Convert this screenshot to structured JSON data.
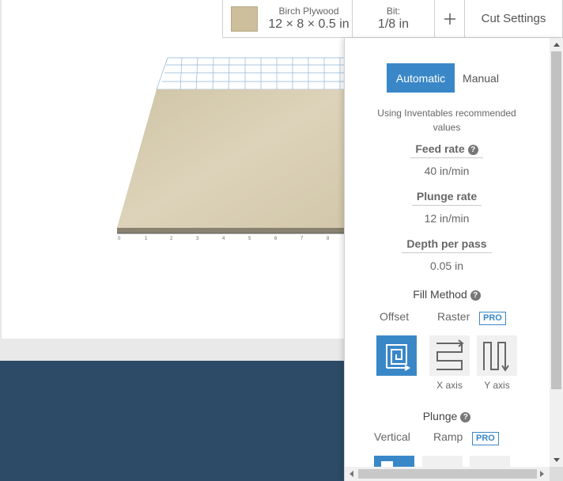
{
  "toolbar": {
    "material_name": "Birch Plywood",
    "material_dims": "12 × 8 × 0.5 in",
    "material_color": "#cdbf9c",
    "bit_label": "Bit:",
    "bit_value": "1/8 in",
    "add_icon": "plus-icon",
    "cut_settings_label": "Cut Settings"
  },
  "panel": {
    "mode_automatic": "Automatic",
    "mode_manual": "Manual",
    "recommend_line1": "Using Inventables recommended",
    "recommend_line2": "values",
    "feed_rate_label": "Feed rate",
    "feed_rate_value": "40 in/min",
    "plunge_rate_label": "Plunge rate",
    "plunge_rate_value": "12 in/min",
    "depth_per_pass_label": "Depth per pass",
    "depth_per_pass_value": "0.05 in",
    "fill_method_title": "Fill Method",
    "fill_offset_label": "Offset",
    "fill_raster_label": "Raster",
    "pro_badge": "PRO",
    "fill_x_caption": "X axis",
    "fill_y_caption": "Y axis",
    "plunge_title": "Plunge",
    "plunge_vertical_label": "Vertical",
    "plunge_ramp_label": "Ramp",
    "help_glyph": "?"
  },
  "colors": {
    "accent": "#3a87c8",
    "bottom_bar": "#2d4b66",
    "board": "#d8ceb3"
  }
}
